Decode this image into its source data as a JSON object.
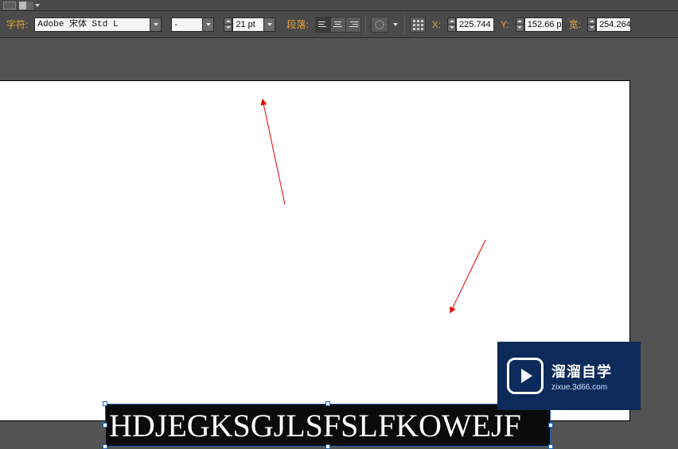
{
  "toolbar": {
    "character_label": "字符:",
    "font_family": "Adobe 宋体 Std L",
    "font_style": "-",
    "font_size": "21 pt",
    "paragraph_label": "段落:",
    "coord_x_label": "X:",
    "coord_x_value": "225.744",
    "coord_y_label": "Y:",
    "coord_y_value": "152.66 p",
    "width_label": "宽:",
    "width_value": "254.264"
  },
  "canvas": {
    "selected_text": "HDJEGKSGJLSFSLFKOWEJF"
  },
  "watermark": {
    "title": "溜溜自学",
    "sub": "zixue.3d66.com"
  }
}
